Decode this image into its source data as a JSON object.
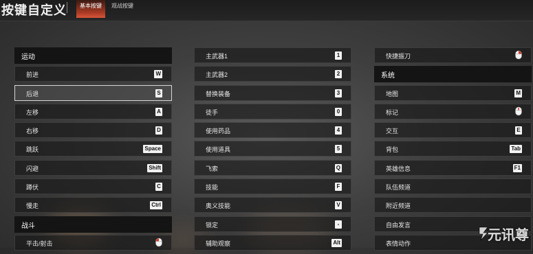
{
  "header": {
    "title": "按键自定义",
    "tabs": [
      {
        "label": "基本按键",
        "active": true
      },
      {
        "label": "观战按键",
        "active": false
      }
    ]
  },
  "columns": [
    {
      "rows": [
        {
          "type": "header",
          "label": "运动"
        },
        {
          "type": "row",
          "label": "前进",
          "key": "W"
        },
        {
          "type": "row",
          "label": "后退",
          "key": "S",
          "selected": true
        },
        {
          "type": "row",
          "label": "左移",
          "key": "A"
        },
        {
          "type": "row",
          "label": "右移",
          "key": "D"
        },
        {
          "type": "row",
          "label": "跳跃",
          "key": "Space"
        },
        {
          "type": "row",
          "label": "闪避",
          "key": "Shift"
        },
        {
          "type": "row",
          "label": "蹲伏",
          "key": "C"
        },
        {
          "type": "row",
          "label": "慢走",
          "key": "Ctrl"
        },
        {
          "type": "header",
          "label": "战斗"
        },
        {
          "type": "row",
          "label": "平击/射击",
          "icon": "mouse-left-icon"
        }
      ]
    },
    {
      "rows": [
        {
          "type": "row",
          "label": "主武器1",
          "key": "1"
        },
        {
          "type": "row",
          "label": "主武器2",
          "key": "2"
        },
        {
          "type": "row",
          "label": "替换装备",
          "key": "3"
        },
        {
          "type": "row",
          "label": "徒手",
          "key": "0"
        },
        {
          "type": "row",
          "label": "使用药品",
          "key": "4"
        },
        {
          "type": "row",
          "label": "使用道具",
          "key": "5"
        },
        {
          "type": "row",
          "label": "飞索",
          "key": "Q"
        },
        {
          "type": "row",
          "label": "技能",
          "key": "F"
        },
        {
          "type": "row",
          "label": "奥义技能",
          "key": "V"
        },
        {
          "type": "row",
          "label": "锁定",
          "key": "-"
        },
        {
          "type": "row",
          "label": "辅助观察",
          "key": "Alt"
        }
      ]
    },
    {
      "rows": [
        {
          "type": "row",
          "label": "快捷振刀",
          "icon": "mouse-right-icon"
        },
        {
          "type": "header",
          "label": "系统"
        },
        {
          "type": "row",
          "label": "地图",
          "key": "M"
        },
        {
          "type": "row",
          "label": "标记",
          "icon": "mouse-middle-icon"
        },
        {
          "type": "row",
          "label": "交互",
          "key": "E"
        },
        {
          "type": "row",
          "label": "背包",
          "key": "Tab"
        },
        {
          "type": "row",
          "label": "英雄信息",
          "key": "F1"
        },
        {
          "type": "row",
          "label": "队伍频道"
        },
        {
          "type": "row",
          "label": "附近频道"
        },
        {
          "type": "row",
          "label": "自由发言"
        },
        {
          "type": "row",
          "label": "表情动作"
        }
      ]
    }
  ],
  "watermark": {
    "text": "元讯尊"
  },
  "colors": {
    "active_tab": "#d9553a",
    "header_bg": "#141414",
    "key_bg": "#f2f2f2"
  }
}
